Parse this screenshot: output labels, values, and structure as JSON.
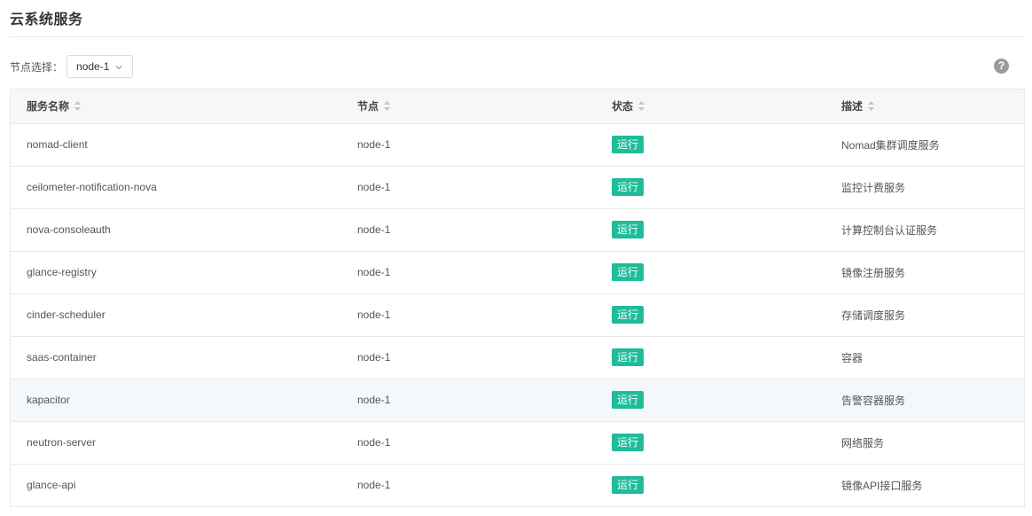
{
  "page": {
    "title": "云系统服务"
  },
  "node_filter": {
    "label": "节点选择：",
    "selected": "node-1"
  },
  "help": {
    "glyph": "?"
  },
  "table": {
    "columns": [
      {
        "label": "服务名称"
      },
      {
        "label": "节点"
      },
      {
        "label": "状态"
      },
      {
        "label": "描述"
      }
    ],
    "rows": [
      {
        "name": "nomad-client",
        "node": "node-1",
        "status": "运行",
        "description": "Nomad集群调度服务"
      },
      {
        "name": "ceilometer-notification-nova",
        "node": "node-1",
        "status": "运行",
        "description": "监控计费服务"
      },
      {
        "name": "nova-consoleauth",
        "node": "node-1",
        "status": "运行",
        "description": "计算控制台认证服务"
      },
      {
        "name": "glance-registry",
        "node": "node-1",
        "status": "运行",
        "description": "镜像注册服务"
      },
      {
        "name": "cinder-scheduler",
        "node": "node-1",
        "status": "运行",
        "description": "存储调度服务"
      },
      {
        "name": "saas-container",
        "node": "node-1",
        "status": "运行",
        "description": "容器"
      },
      {
        "name": "kapacitor",
        "node": "node-1",
        "status": "运行",
        "description": "告警容器服务"
      },
      {
        "name": "neutron-server",
        "node": "node-1",
        "status": "运行",
        "description": "网络服务"
      },
      {
        "name": "glance-api",
        "node": "node-1",
        "status": "运行",
        "description": "镜像API接口服务"
      }
    ]
  },
  "colors": {
    "status_running": "#1ebc99",
    "header_bg": "#f7f7f7",
    "border": "#e8e8e8",
    "row_hover": "#f4f7fb"
  },
  "icons": {
    "select_chevron": "chevron-down-icon",
    "sort": "sort-icon",
    "help": "help-icon"
  }
}
